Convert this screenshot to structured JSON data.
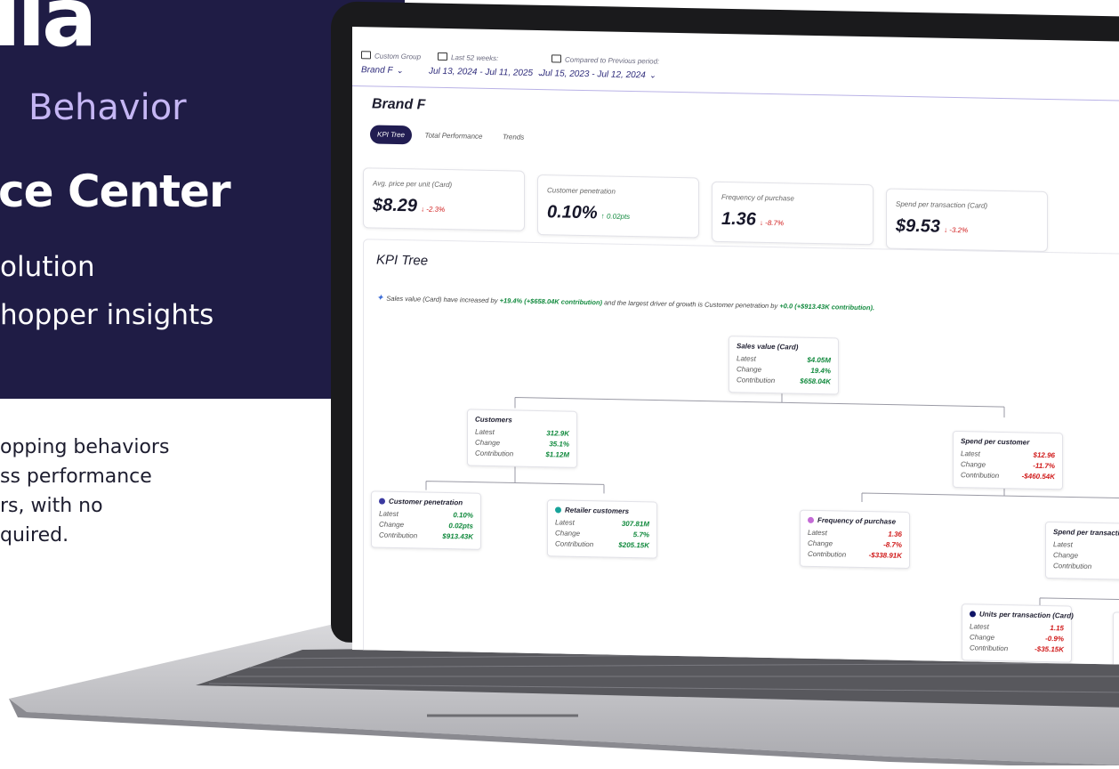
{
  "hero": {
    "logo": "lla",
    "kicker": "Behavior",
    "headline": "ce Center",
    "line1": "olution",
    "line2": "hopper insights",
    "body": [
      "opping behaviors",
      "ss performance",
      "rs, with no",
      "quired."
    ]
  },
  "filters": [
    {
      "label": "Custom Group",
      "value": "Brand F",
      "icon": "group-icon"
    },
    {
      "label": "Last 52 weeks:",
      "value": "Jul 13, 2024 - Jul 11, 2025",
      "icon": "calendar-icon"
    },
    {
      "label": "Compared to Previous period:",
      "value": "Jul 15, 2023 - Jul 12, 2024",
      "icon": "calendar-icon"
    }
  ],
  "page_title": "Brand F",
  "tabs": [
    "KPI Tree",
    "Total Performance",
    "Trends"
  ],
  "active_tab": "KPI Tree",
  "kpis": [
    {
      "label": "Avg. price per unit (Card)",
      "value": "$8.29",
      "delta": "↓ -2.3%",
      "trend": "neg"
    },
    {
      "label": "Customer penetration",
      "value": "0.10%",
      "delta": "↑ 0.02pts",
      "trend": "pos"
    },
    {
      "label": "Frequency of purchase",
      "value": "1.36",
      "delta": "↓ -8.7%",
      "trend": "neg"
    },
    {
      "label": "Spend per transaction (Card)",
      "value": "$9.53",
      "delta": "↓ -3.2%",
      "trend": "neg"
    }
  ],
  "tree": {
    "title": "KPI Tree",
    "insight_pre": "Sales value (Card) have increased by",
    "insight_hl1": "+19.4% (+$658.04K contribution)",
    "insight_mid": "and the largest driver of growth is Customer penetration by",
    "insight_hl2": "+0.0 (+$913.43K contribution).",
    "row_labels": {
      "latest": "Latest",
      "change": "Change",
      "contribution": "Contribution"
    },
    "nodes": [
      {
        "title": "Sales value (Card)",
        "latest": "$4.05M",
        "change": "19.4%",
        "contribution": "$658.04K",
        "dot": "",
        "trend": "pos"
      },
      {
        "title": "Customers",
        "latest": "312.9K",
        "change": "35.1%",
        "contribution": "$1.12M",
        "dot": "",
        "trend": "pos"
      },
      {
        "title": "Spend per customer",
        "latest": "$12.96",
        "change": "-11.7%",
        "contribution": "-$460.54K",
        "dot": "",
        "trend": "neg"
      },
      {
        "title": "Customer penetration",
        "latest": "0.10%",
        "change": "0.02pts",
        "contribution": "$913.43K",
        "dot": "#3b3aa0",
        "trend": "pos"
      },
      {
        "title": "Retailer customers",
        "latest": "307.81M",
        "change": "5.7%",
        "contribution": "$205.15K",
        "dot": "#17a39a",
        "trend": "pos"
      },
      {
        "title": "Frequency of purchase",
        "latest": "1.36",
        "change": "-8.7%",
        "contribution": "-$338.91K",
        "dot": "#c46bd6",
        "trend": "neg"
      },
      {
        "title": "Spend per transaction (",
        "latest": "",
        "change": "",
        "contribution": "-$",
        "dot": "",
        "trend": "neg"
      },
      {
        "title": "Units per transaction (Card)",
        "latest": "1.15",
        "change": "-0.9%",
        "contribution": "-$35.15K",
        "dot": "#0f1466",
        "trend": "neg"
      },
      {
        "title": "",
        "latest": "",
        "change": "",
        "contribution": "",
        "dot": "#8cc63f",
        "trend": "neg",
        "row_labels_short": [
          "La",
          "Ch",
          "Co"
        ]
      }
    ]
  },
  "colors": {
    "navy": "#1f1c45",
    "accent": "#211d52",
    "positive": "#128a3e",
    "negative": "#d01a1a"
  }
}
